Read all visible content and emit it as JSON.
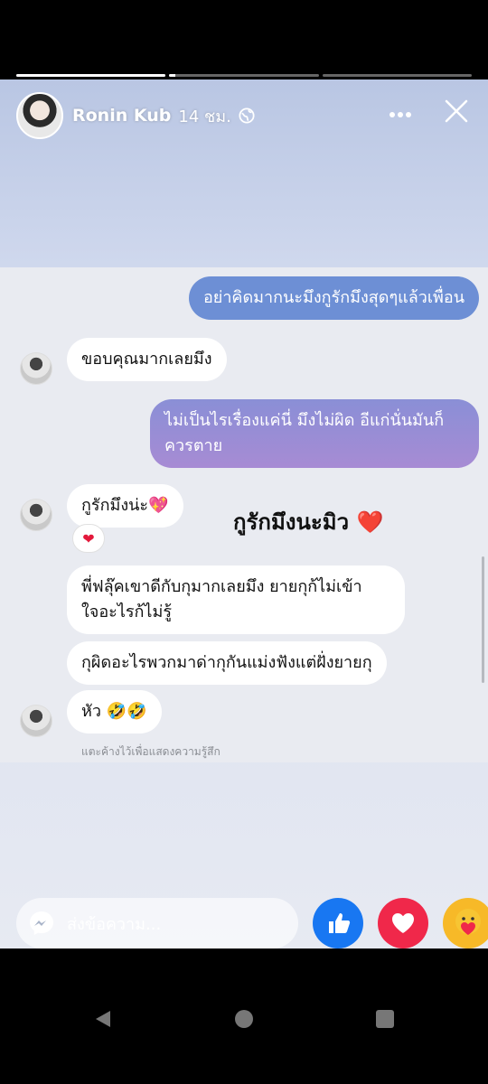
{
  "story": {
    "progress": [
      1,
      0.04,
      0
    ],
    "user_name": "Ronin Kub",
    "time_label": "14 ชม.",
    "privacy_icon": "globe-icon"
  },
  "messages": [
    {
      "side": "out",
      "text": "อย่าคิดมากนะมึงกูรักมึงสุดๆแล้วเพื่อน"
    },
    {
      "side": "in",
      "text": "ขอบคุณมากเลยมึง"
    },
    {
      "side": "out",
      "line1": "ไม่เป็นไรเรื่องแค่นี่ มึงไม่ผิด อีแก่นั่นมันก็",
      "line2": "ควรตาย"
    },
    {
      "side": "in",
      "text": "กูรักมึงน่ะ💖",
      "reaction": "❤"
    },
    {
      "side": "in",
      "line1": "พี่ฟลุ๊คเขาดีกับกุมากเลยมึง ยายกุก้ไม่เข้า",
      "line2": "ใจอะไรก้ไม่รู้"
    },
    {
      "side": "in",
      "text": "กุผิดอะไรพวกมาด่ากุกันแม่งฟังแต่ฝั่งยายกุ"
    },
    {
      "side": "in",
      "text": "หัว 🤣🤣"
    }
  ],
  "caption": {
    "text": "กูรักมึงนะมิว",
    "heart": "❤️"
  },
  "hint": "แตะค้างไว้เพื่อแสดงความรู้สึก",
  "reply": {
    "placeholder": "ส่งข้อความ..."
  },
  "reactions": [
    "like-icon",
    "love-icon",
    "care-icon"
  ],
  "colors": {
    "like": "#1877f2",
    "love": "#f0284a",
    "care": "#f7b928",
    "bubble_out_top": "#6b8fd6",
    "bubble_out_bottom": "#a78bd4"
  }
}
